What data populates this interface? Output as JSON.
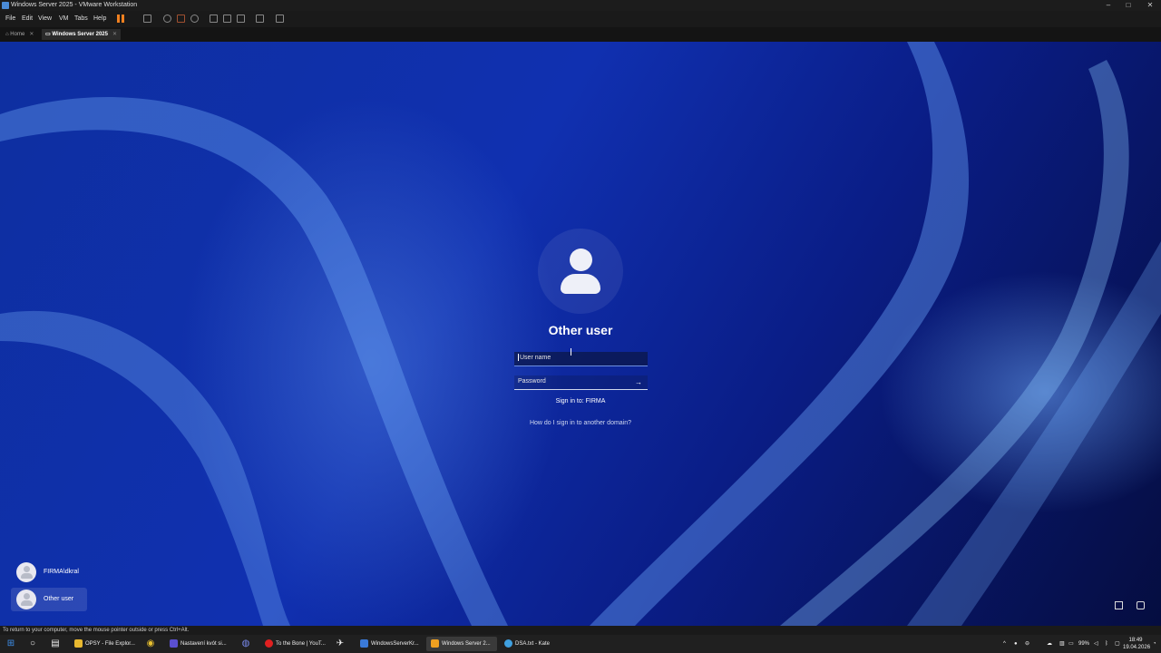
{
  "window": {
    "title": "Windows Server 2025 - VMware Workstation",
    "controls": [
      "–",
      "□",
      "✕"
    ]
  },
  "menu": [
    "File",
    "Edit",
    "View",
    "VM",
    "Tabs",
    "Help"
  ],
  "tabs": [
    {
      "label": "Home",
      "close": "✕"
    },
    {
      "label": "Windows Server 2025",
      "close": "✕"
    }
  ],
  "login": {
    "display_name": "Other user",
    "username_placeholder": "User name",
    "password_placeholder": "Password",
    "submit_icon": "arrow-right-icon",
    "sign_in_to": "Sign in to: FIRMA",
    "help_link": "How do I sign in to another domain?"
  },
  "user_list": [
    {
      "name": "FIRMA\\dkral"
    },
    {
      "name": "Other user"
    }
  ],
  "status_message": "To return to your computer, move the mouse pointer outside or press Ctrl+Alt.",
  "taskbar": {
    "tasks": [
      {
        "label": "OPSY - File Explor...",
        "color": "#e8b830"
      },
      {
        "label": "Nastavení kvót si...",
        "color": "#5a4fd0"
      },
      {
        "label": "To the Bone | YouT...",
        "color": "#e02020"
      },
      {
        "label": "WindowsServerKr...",
        "color": "#3a7ad8"
      },
      {
        "label": "Windows Server 2...",
        "color": "#f0a020"
      },
      {
        "label": "DSA.txt - Kate",
        "color": "#3fa0e0"
      }
    ],
    "battery": "99%",
    "time": "18:49",
    "date": "19.04.2026"
  },
  "colors": {
    "accent_pause": "#f08020",
    "background_blue": "#1030b0"
  }
}
